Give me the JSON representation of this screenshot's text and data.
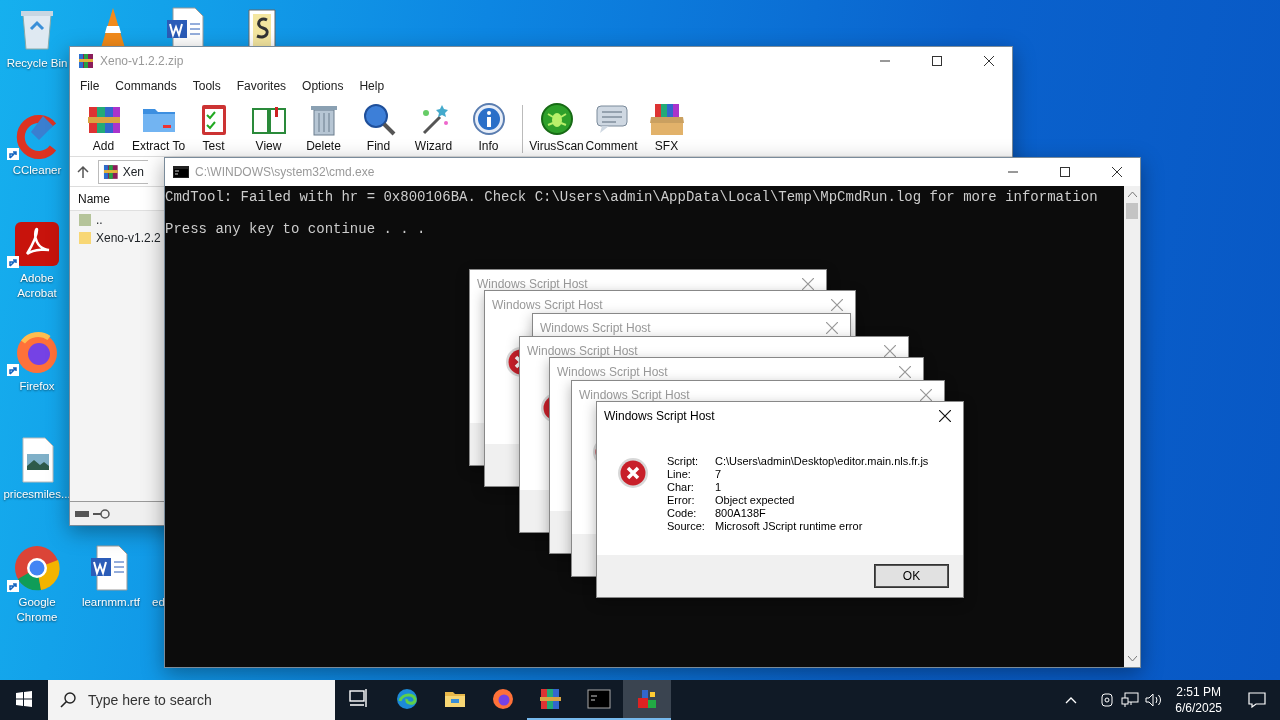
{
  "desktop_icons": [
    {
      "label": "Recycle Bin",
      "kind": "recycle"
    },
    {
      "kind": "cone"
    },
    {
      "kind": "word"
    },
    {
      "kind": "script"
    },
    {
      "label": "CCleaner",
      "kind": "ccleaner",
      "shortcut": true
    },
    {
      "label": "Adobe Acrobat",
      "kind": "acrobat",
      "shortcut": true
    },
    {
      "label": "Firefox",
      "kind": "firefox",
      "shortcut": true
    },
    {
      "label": "pricesmiles...",
      "kind": "image"
    },
    {
      "label": "Google Chrome",
      "kind": "chrome",
      "shortcut": true
    },
    {
      "label": "learnmm.rtf",
      "kind": "word"
    },
    {
      "label": "ed"
    }
  ],
  "archiver_window": {
    "title": "Xeno-v1.2.2.zip",
    "active": false,
    "menu": [
      "File",
      "Commands",
      "Tools",
      "Favorites",
      "Options",
      "Help"
    ],
    "toolbar": [
      {
        "label": "Add",
        "kind": "add"
      },
      {
        "label": "Extract To",
        "kind": "extract"
      },
      {
        "label": "Test",
        "kind": "test"
      },
      {
        "label": "View",
        "kind": "view"
      },
      {
        "label": "Delete",
        "kind": "delete"
      },
      {
        "label": "Find",
        "kind": "find"
      },
      {
        "label": "Wizard",
        "kind": "wizard"
      },
      {
        "label": "Info",
        "kind": "info"
      },
      {
        "label": "VirusScan",
        "kind": "virus"
      },
      {
        "label": "Comment",
        "kind": "comment"
      },
      {
        "label": "SFX",
        "kind": "sfx"
      }
    ],
    "path": "Xen",
    "list_header": "Name",
    "files": [
      {
        "name": "..",
        "kind": "up"
      },
      {
        "name": "Xeno-v1.2.2",
        "kind": "folder"
      }
    ]
  },
  "console_window": {
    "title": "C:\\WINDOWS\\system32\\cmd.exe",
    "active": false,
    "lines": [
      "CmdTool: Failed with hr = 0x800106BA. Check C:\\Users\\admin\\AppData\\Local\\Temp\\MpCmdRun.log for more information",
      "Press any key to continue . . ."
    ]
  },
  "dialogs": [
    {
      "title": "Windows Script Host",
      "active": false
    },
    {
      "title": "Windows Script Host",
      "active": false
    },
    {
      "title": "Windows Script Host",
      "active": false
    },
    {
      "title": "Windows Script Host",
      "active": false
    },
    {
      "title": "Windows Script Host",
      "active": false
    },
    {
      "title": "Windows Script Host",
      "active": false
    },
    {
      "title": "Windows Script Host",
      "active": true,
      "fields": [
        {
          "label": "Script:",
          "value": "C:\\Users\\admin\\Desktop\\editor.main.nls.fr.js"
        },
        {
          "label": "Line:",
          "value": "7"
        },
        {
          "label": "Char:",
          "value": "1"
        },
        {
          "label": "Error:",
          "value": "Object expected"
        },
        {
          "label": "Code:",
          "value": "800A138F"
        },
        {
          "label": "Source:",
          "value": "Microsoft JScript runtime error"
        }
      ],
      "button": "OK"
    }
  ],
  "taskbar": {
    "search": {
      "placeholder": "Type here to search"
    },
    "apps": [
      {
        "kind": "taskview",
        "open": false,
        "selected": false
      },
      {
        "kind": "edge",
        "open": false,
        "selected": false
      },
      {
        "kind": "explorer",
        "open": false,
        "selected": false
      },
      {
        "kind": "firefox",
        "open": false,
        "selected": false
      },
      {
        "kind": "archiver",
        "open": true,
        "selected": false
      },
      {
        "kind": "console",
        "open": true,
        "selected": false
      },
      {
        "kind": "blocks",
        "open": true,
        "selected": true
      }
    ],
    "time": "2:51 PM",
    "date": "6/6/2025"
  }
}
